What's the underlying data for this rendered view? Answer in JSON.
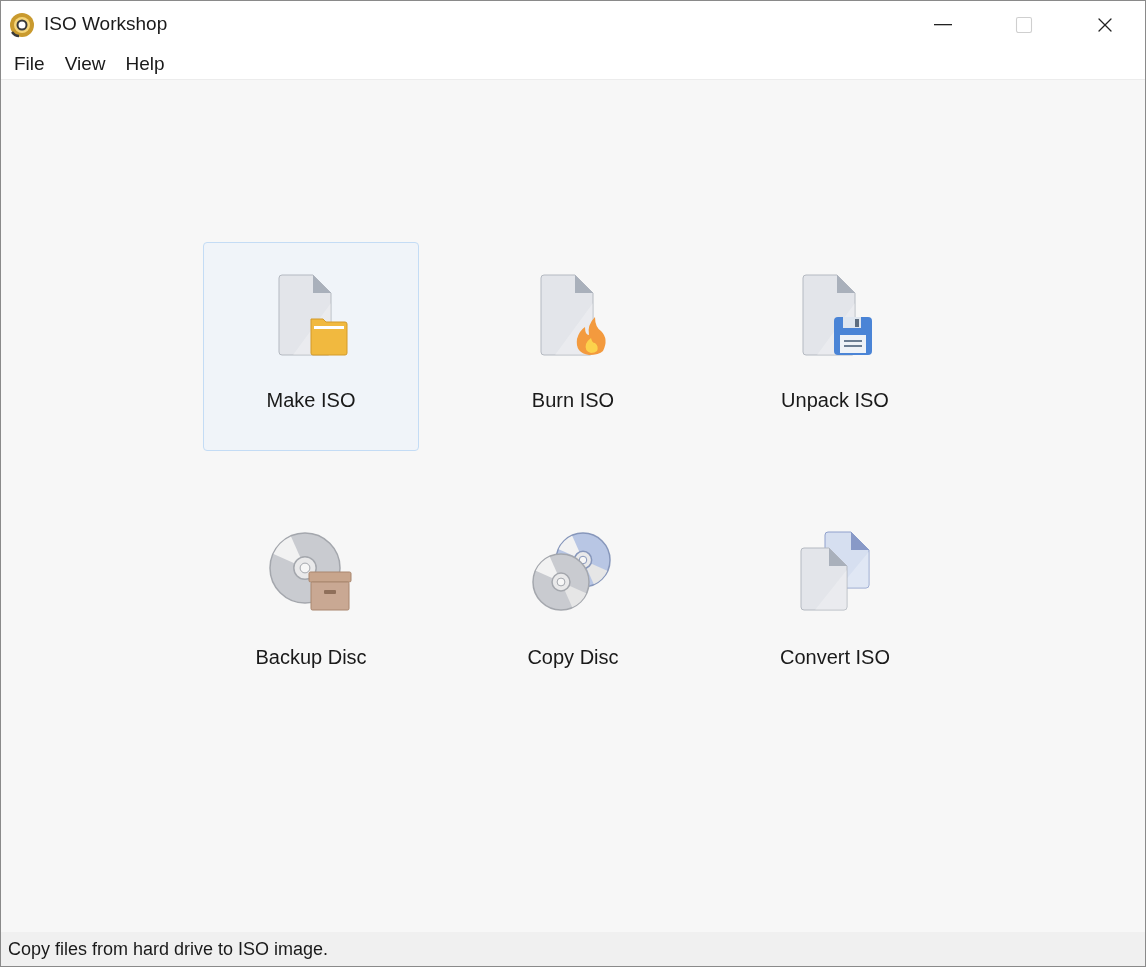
{
  "window": {
    "title": "ISO Workshop",
    "controls": [
      {
        "kind": "minimize",
        "disabled": false
      },
      {
        "kind": "maximize",
        "disabled": true
      },
      {
        "kind": "close",
        "disabled": false
      }
    ]
  },
  "menu": [
    "File",
    "View",
    "Help"
  ],
  "tiles": [
    {
      "kind": "make",
      "label": "Make ISO",
      "selected": true
    },
    {
      "kind": "burn",
      "label": "Burn ISO",
      "selected": false
    },
    {
      "kind": "unpack",
      "label": "Unpack ISO",
      "selected": false
    },
    {
      "kind": "backup",
      "label": "Backup Disc",
      "selected": false
    },
    {
      "kind": "copy",
      "label": "Copy Disc",
      "selected": false
    },
    {
      "kind": "convert",
      "label": "Convert ISO",
      "selected": false
    }
  ],
  "status_bar": "Copy files from hard drive to ISO image."
}
